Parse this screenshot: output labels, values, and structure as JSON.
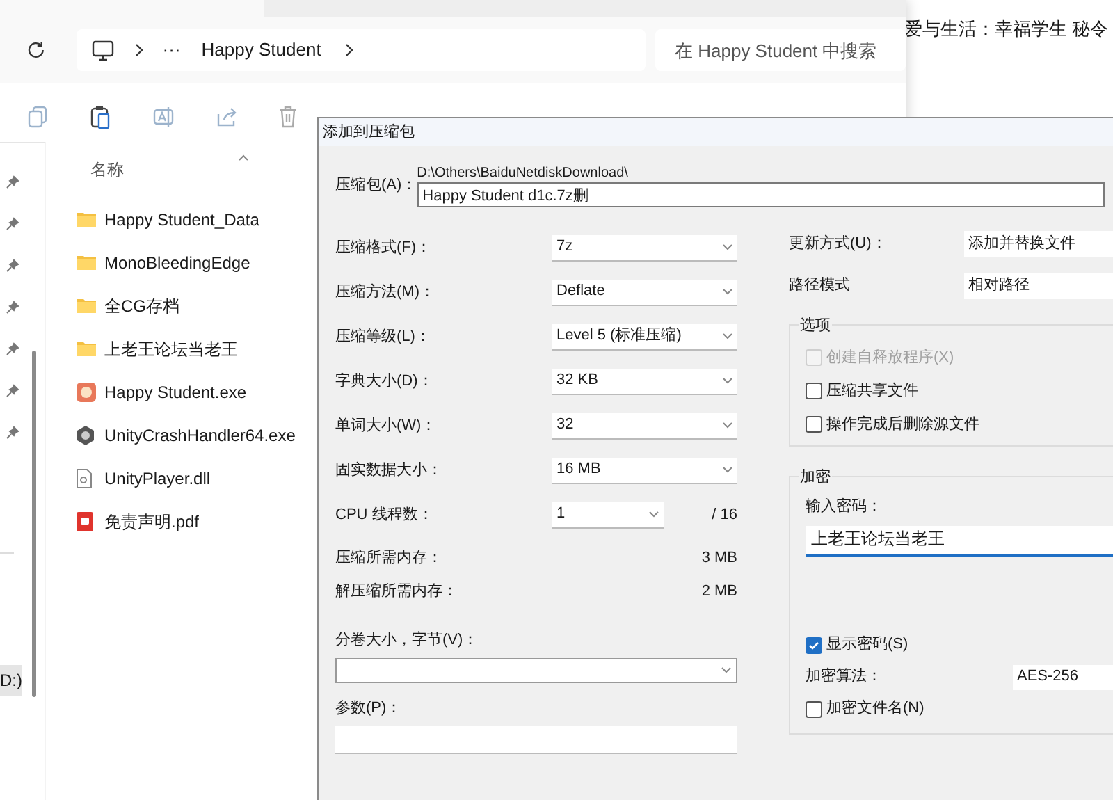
{
  "background_text": "爱与生活：幸福学生 秘令",
  "explorer": {
    "breadcrumb": {
      "more": "···",
      "folder": "Happy Student"
    },
    "search": {
      "placeholder": "在 Happy Student 中搜索"
    },
    "column_header": "名称",
    "files": [
      {
        "name": "Happy Student_Data",
        "kind": "folder"
      },
      {
        "name": "MonoBleedingEdge",
        "kind": "folder"
      },
      {
        "name": "全CG存档",
        "kind": "folder"
      },
      {
        "name": "上老王论坛当老王",
        "kind": "folder"
      },
      {
        "name": "Happy Student.exe",
        "kind": "app"
      },
      {
        "name": "UnityCrashHandler64.exe",
        "kind": "exe"
      },
      {
        "name": "UnityPlayer.dll",
        "kind": "dll"
      },
      {
        "name": "免责声明.pdf",
        "kind": "pdf"
      }
    ],
    "nav_drive": "D:)"
  },
  "dialog": {
    "title": "添加到压缩包",
    "archive": {
      "label": "压缩包(A)：",
      "path": "D:\\Others\\BaiduNetdiskDownload\\",
      "value": "Happy Student d1c.7z删"
    },
    "settings": [
      {
        "label": "压缩格式(F)：",
        "value": "7z"
      },
      {
        "label": "压缩方法(M)：",
        "value": "Deflate"
      },
      {
        "label": "压缩等级(L)：",
        "value": "Level 5 (标准压缩)"
      },
      {
        "label": "字典大小(D)：",
        "value": "32 KB"
      },
      {
        "label": "单词大小(W)：",
        "value": "32"
      },
      {
        "label": "固实数据大小：",
        "value": "16 MB"
      }
    ],
    "cpu": {
      "label": "CPU 线程数：",
      "value": "1",
      "total": "/ 16"
    },
    "memory": [
      {
        "label": "压缩所需内存：",
        "value": "3 MB"
      },
      {
        "label": "解压缩所需内存：",
        "value": "2 MB"
      }
    ],
    "volume": {
      "label": "分卷大小，字节(V)："
    },
    "params": {
      "label": "参数(P)："
    },
    "update": {
      "label": "更新方式(U)：",
      "value": "添加并替换文件"
    },
    "path_mode": {
      "label": "路径模式",
      "value": "相对路径"
    },
    "options": {
      "title": "选项",
      "items": [
        {
          "label": "创建自释放程序(X)",
          "checked": false,
          "disabled": true
        },
        {
          "label": "压缩共享文件",
          "checked": false,
          "disabled": false
        },
        {
          "label": "操作完成后删除源文件",
          "checked": false,
          "disabled": false
        }
      ]
    },
    "encryption": {
      "title": "加密",
      "password_label": "输入密码：",
      "password": "上老王论坛当老王",
      "show_password": {
        "label": "显示密码(S)",
        "checked": true
      },
      "algorithm": {
        "label": "加密算法：",
        "value": "AES-256"
      },
      "encrypt_names": {
        "label": "加密文件名(N)",
        "checked": false
      }
    }
  }
}
